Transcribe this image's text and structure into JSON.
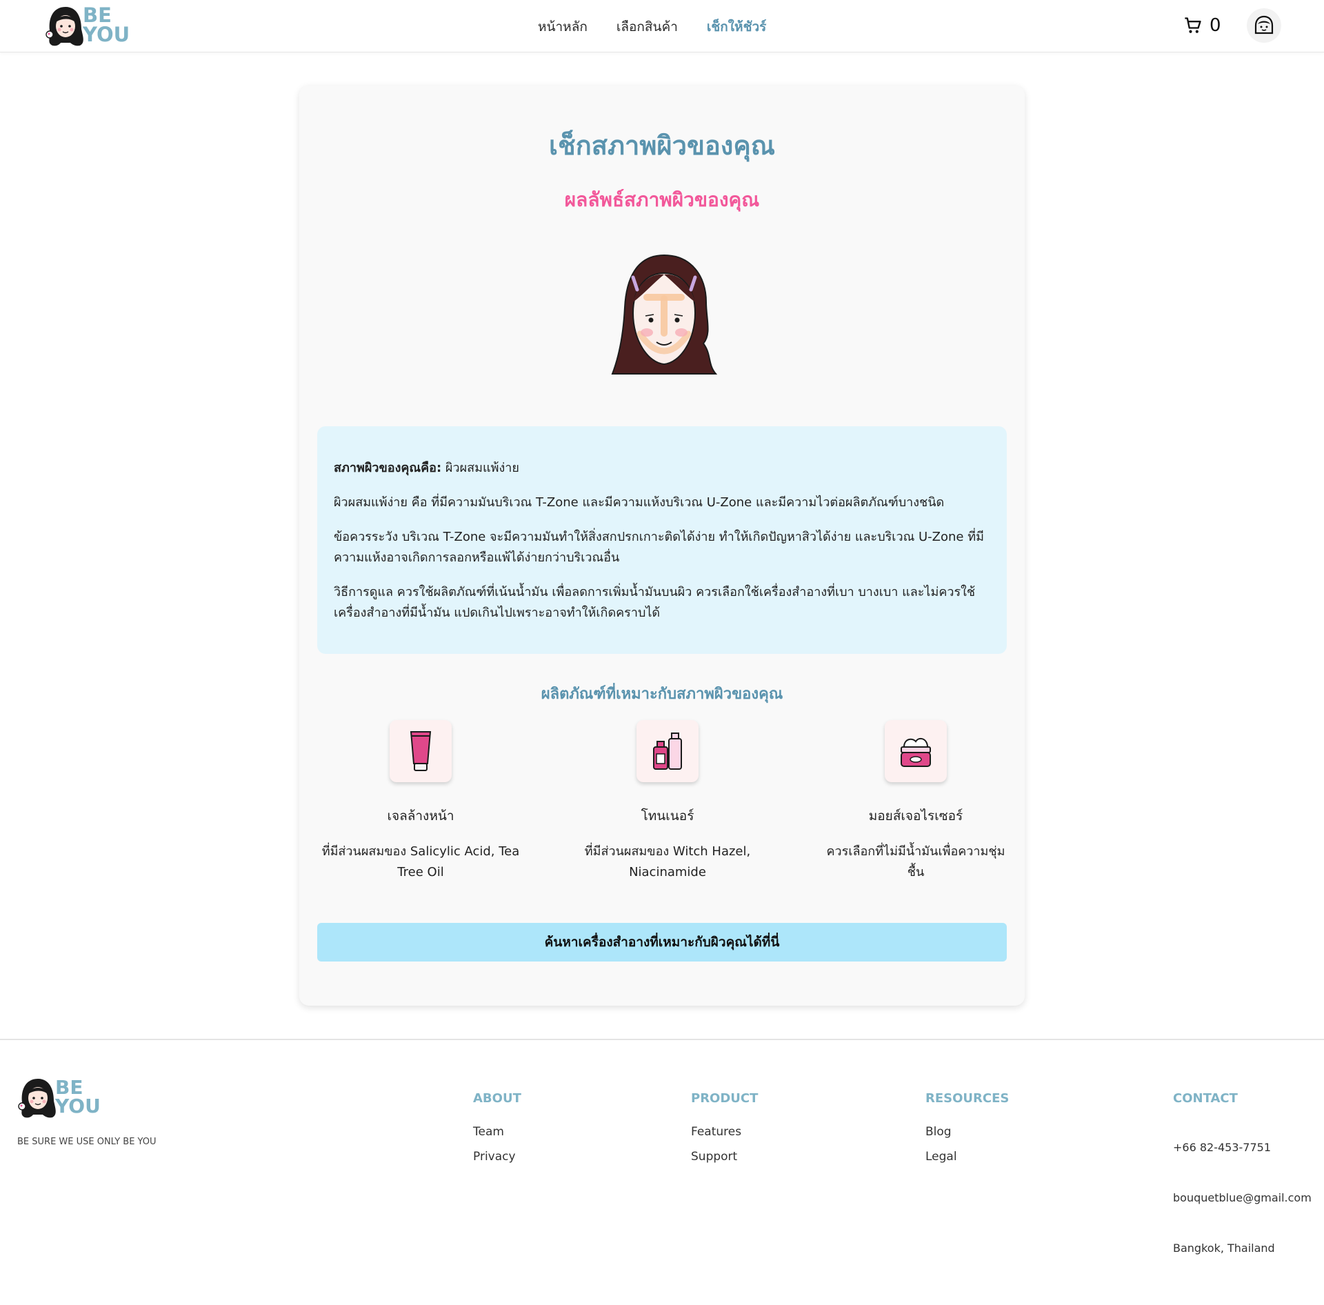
{
  "header": {
    "logo_line1": "BE",
    "logo_line2": "YOU",
    "nav": [
      {
        "label": "หน้าหลัก"
      },
      {
        "label": "เลือกสินค้า"
      },
      {
        "label": "เช็กให้ชัวร์"
      }
    ],
    "active_nav": "เช็กให้ชัวร์",
    "cart_count": "0"
  },
  "main": {
    "title": "เช็กสภาพผิวของคุณ",
    "result_title": "ผลลัพธ์สภาพผิวของคุณ",
    "skin_label": "สภาพผิวของคุณคือ:",
    "skin_value": "ผิวผสมแพ้ง่าย",
    "paragraphs": [
      "ผิวผสมแพ้ง่าย คือ ที่มีความมันบริเวณ T-Zone และมีความแห้งบริเวณ U-Zone และมีความไวต่อผลิตภัณฑ์บางชนิด",
      "ข้อควรระวัง บริเวณ T-Zone จะมีความมันทำให้สิ่งสกปรกเกาะติดได้ง่าย ทำให้เกิดปัญหาสิวได้ง่าย และบริเวณ U-Zone ที่มีความแห้งอาจเกิดการลอกหรือแพ้ได้ง่ายกว่าบริเวณอื่น",
      "วิธีการดูแล ควรใช้ผลิตภัณฑ์ที่เน้นน้ำมัน เพื่อลดการเพิ่มน้ำมันบนผิว ควรเลือกใช้เครื่องสำอางที่เบา บางเบา และไม่ควรใช้เครื่องสำอางที่มีน้ำมัน แปดเกินไปเพราะอาจทำให้เกิดคราบได้"
    ],
    "products_title": "ผลิตภัณฑ์ที่เหมาะกับสภาพผิวของคุณ",
    "products": [
      {
        "name": "เจลล้างหน้า",
        "desc": "ที่มีส่วนผสมของ Salicylic Acid, Tea Tree Oil",
        "icon": "cleanser-tube-icon"
      },
      {
        "name": "โทนเนอร์",
        "desc": "ที่มีส่วนผสมของ Witch Hazel, Niacinamide",
        "icon": "toner-bottles-icon"
      },
      {
        "name": "มอยส์เจอไรเซอร์",
        "desc": "ควรเลือกที่ไม่มีน้ำมันเพื่อความชุ่มชื้น",
        "icon": "cream-jar-icon"
      }
    ],
    "cta_label": "ค้นหาเครื่องสำอางที่เหมาะกับผิวคุณได้ที่นี่"
  },
  "footer": {
    "logo_line1": "BE",
    "logo_line2": "YOU",
    "tagline": "BE SURE WE USE ONLY BE YOU",
    "columns": [
      {
        "heading": "ABOUT",
        "links": [
          "Team",
          "Privacy"
        ]
      },
      {
        "heading": "PRODUCT",
        "links": [
          "Features",
          "Support"
        ]
      },
      {
        "heading": "RESOURCES",
        "links": [
          "Blog",
          "Legal"
        ]
      }
    ],
    "contact": {
      "heading": "CONTACT",
      "phone": "+66 82-453-7751",
      "email": "bouquetblue@gmail.com",
      "location": "Bangkok, Thailand"
    }
  },
  "colors": {
    "brand_blue": "#5a93ae",
    "logo_blue": "#7fb3c6",
    "accent_pink": "#f2589a",
    "info_bg": "#e2f5fc",
    "cta_bg": "#ade6fa"
  }
}
